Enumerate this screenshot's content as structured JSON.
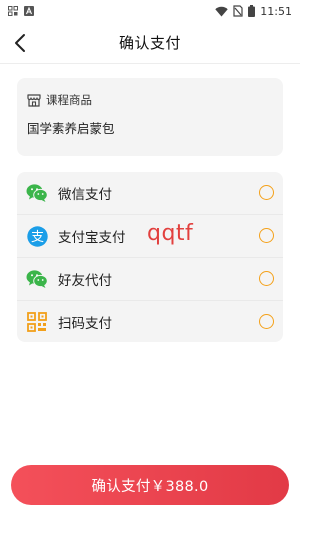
{
  "status_bar": {
    "time": "11:51",
    "icons": [
      "screenshot-icon",
      "app-a-icon",
      "wifi-icon",
      "no-sim-icon",
      "battery-icon"
    ]
  },
  "nav": {
    "title": "确认支付",
    "back_icon": "chevron-left-icon"
  },
  "product": {
    "section_label": "课程商品",
    "name": "国学素养启蒙包",
    "icon": "store-icon"
  },
  "payment_methods": [
    {
      "label": "微信支付",
      "icon": "wechat-icon",
      "color": "#3bb54a"
    },
    {
      "label": "支付宝支付",
      "icon": "alipay-icon",
      "color": "#1b9ee8"
    },
    {
      "label": "好友代付",
      "icon": "wechat-friend-icon",
      "color": "#3bb54a"
    },
    {
      "label": "扫码支付",
      "icon": "qr-code-icon",
      "color": "#f2a01b"
    }
  ],
  "radio_color": "#f4a11a",
  "watermark": "qqtf",
  "confirm_button": {
    "label": "确认支付￥388.0",
    "color_start": "#f4505a",
    "color_end": "#e23a46"
  }
}
